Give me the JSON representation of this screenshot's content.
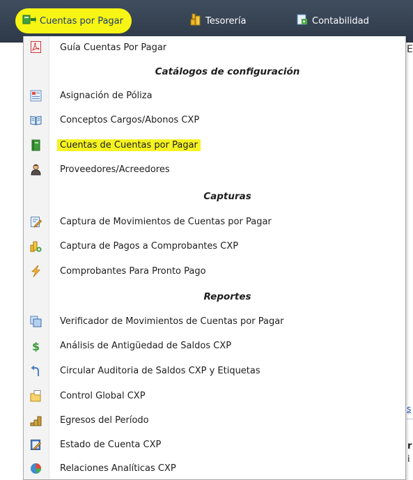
{
  "topnav": {
    "items": [
      {
        "label": "Cuentas por Pagar",
        "icon": "ledger-folder-icon"
      },
      {
        "label": "Tesorería",
        "icon": "coins-icon"
      },
      {
        "label": "Contabilidad",
        "icon": "accounting-doc-icon"
      }
    ]
  },
  "menu": {
    "guide": {
      "label": "Guía Cuentas Por Pagar",
      "icon": "pdf-icon"
    },
    "sections": [
      {
        "title": "Catálogos de configuración",
        "items": [
          {
            "label": "Asignación de Póliza",
            "icon": "policy-form-icon"
          },
          {
            "label": "Conceptos Cargos/Abonos CXP",
            "icon": "open-book-icon"
          },
          {
            "label": "Cuentas de Cuentas por Pagar",
            "icon": "green-ledger-icon",
            "highlighted": true
          },
          {
            "label": "Proveedores/Acreedores",
            "icon": "person-icon"
          }
        ]
      },
      {
        "title": "Capturas",
        "items": [
          {
            "label": "Captura de Movimientos de Cuentas por Pagar",
            "icon": "edit-document-icon"
          },
          {
            "label": "Captura de Pagos a Comprobantes CXP",
            "icon": "coins-add-icon"
          },
          {
            "label": "Comprobantes Para Pronto Pago",
            "icon": "lightning-icon"
          }
        ]
      },
      {
        "title": "Reportes",
        "items": [
          {
            "label": "Verificador de Movimientos de Cuentas por Pagar",
            "icon": "copy-pages-icon"
          },
          {
            "label": "Análisis de Antigüedad de Saldos CXP",
            "icon": "dollar-icon"
          },
          {
            "label": "Circular Auditoria de Saldos CXP y Etiquetas",
            "icon": "arrow-back-icon"
          },
          {
            "label": "Control Global CXP",
            "icon": "folder-page-icon"
          },
          {
            "label": "Egresos del Período",
            "icon": "coin-stack-icon"
          },
          {
            "label": "Estado de Cuenta CXP",
            "icon": "statement-edit-icon"
          },
          {
            "label": "Relaciones Analíticas CXP",
            "icon": "pie-chart-icon"
          }
        ]
      }
    ]
  },
  "colors": {
    "highlight": "#f5f321",
    "navbar": "#3a4757"
  },
  "background_fragments": {
    "e": "E",
    "s": "s",
    "r": "r",
    "i": "i"
  }
}
